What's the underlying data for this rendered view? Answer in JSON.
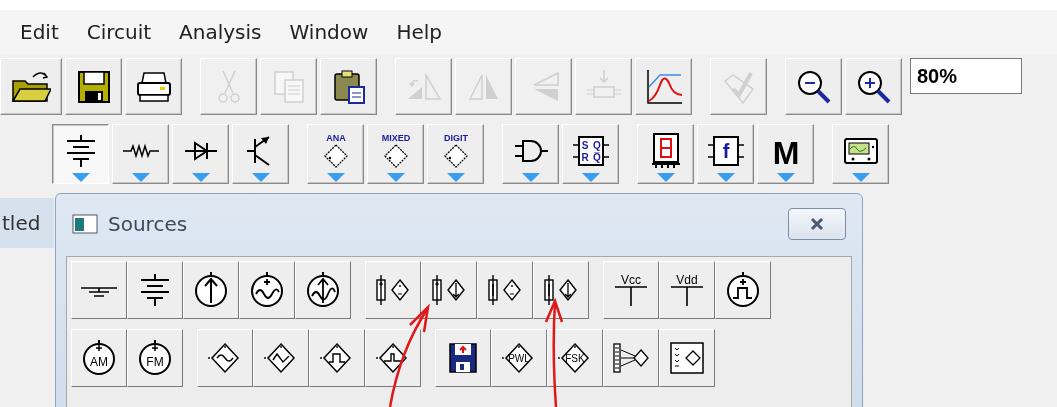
{
  "menu_bar": [
    {
      "label": "Edit"
    },
    {
      "label": "Circuit"
    },
    {
      "label": "Analysis"
    },
    {
      "label": "Window"
    },
    {
      "label": "Help"
    }
  ],
  "toolbar": {
    "rows": [
      {
        "groups": [
          [
            {
              "kind": "open",
              "disabled": false
            },
            {
              "kind": "save",
              "disabled": false
            },
            {
              "kind": "print",
              "disabled": false
            }
          ],
          [
            {
              "kind": "cut",
              "disabled": true
            },
            {
              "kind": "copy",
              "disabled": true
            },
            {
              "kind": "paste",
              "disabled": false
            }
          ],
          [
            {
              "kind": "flip",
              "disabled": true
            },
            {
              "kind": "mirror",
              "disabled": true
            },
            {
              "kind": "rotate",
              "disabled": true
            },
            {
              "kind": "subcircuit",
              "disabled": true
            },
            {
              "kind": "grapher",
              "disabled": false
            }
          ],
          [
            {
              "kind": "check",
              "disabled": true
            }
          ],
          [
            {
              "kind": "zoom-out",
              "disabled": false
            },
            {
              "kind": "zoom-in",
              "disabled": false
            }
          ]
        ]
      },
      {
        "groups": [
          [
            {
              "kind": "battery",
              "selected": true
            },
            {
              "kind": "resistor",
              "selected": false
            },
            {
              "kind": "diode",
              "selected": false
            },
            {
              "kind": "transistor",
              "selected": false
            }
          ],
          [
            {
              "kind": "chip",
              "label": "ANA",
              "selected": false
            },
            {
              "kind": "chip",
              "label": "MIXED",
              "selected": false
            },
            {
              "kind": "chip",
              "label": "DIGIT",
              "selected": false
            }
          ],
          [
            {
              "kind": "gate",
              "selected": false
            },
            {
              "kind": "flipflop",
              "labels": [
                "S",
                "Q",
                "R",
                "Q̅"
              ],
              "selected": false
            }
          ],
          [
            {
              "kind": "seven-seg",
              "selected": false
            },
            {
              "kind": "function",
              "label": "f",
              "selected": false
            },
            {
              "kind": "letter",
              "label": "M",
              "selected": false
            }
          ],
          [
            {
              "kind": "scope",
              "selected": false
            }
          ]
        ]
      }
    ],
    "zoom_field": {
      "value": "80%"
    }
  },
  "document_tab": {
    "label": "tled"
  },
  "sources_panel": {
    "title": "Sources",
    "rows": [
      {
        "groups": [
          [
            {
              "kind": "ground"
            },
            {
              "kind": "dc-battery"
            },
            {
              "kind": "current-source"
            },
            {
              "kind": "ac-voltage"
            },
            {
              "kind": "ac-current"
            }
          ],
          [
            {
              "kind": "vcvs"
            },
            {
              "kind": "vccs"
            },
            {
              "kind": "ccvs"
            },
            {
              "kind": "cccs"
            }
          ],
          [
            {
              "kind": "rail",
              "label": "Vcc"
            },
            {
              "kind": "rail",
              "label": "Vdd"
            },
            {
              "kind": "clock"
            }
          ]
        ]
      },
      {
        "groups": [
          [
            {
              "kind": "modulated",
              "label": "AM"
            },
            {
              "kind": "modulated",
              "label": "FM"
            }
          ],
          [
            {
              "kind": "dep-sine"
            },
            {
              "kind": "dep-triangle"
            },
            {
              "kind": "dep-square"
            },
            {
              "kind": "dep-pulse"
            }
          ],
          [
            {
              "kind": "disk"
            },
            {
              "kind": "dep-text",
              "label": "PWL"
            },
            {
              "kind": "dep-text",
              "label": "FSK"
            },
            {
              "kind": "mux"
            },
            {
              "kind": "block"
            }
          ]
        ]
      }
    ]
  }
}
